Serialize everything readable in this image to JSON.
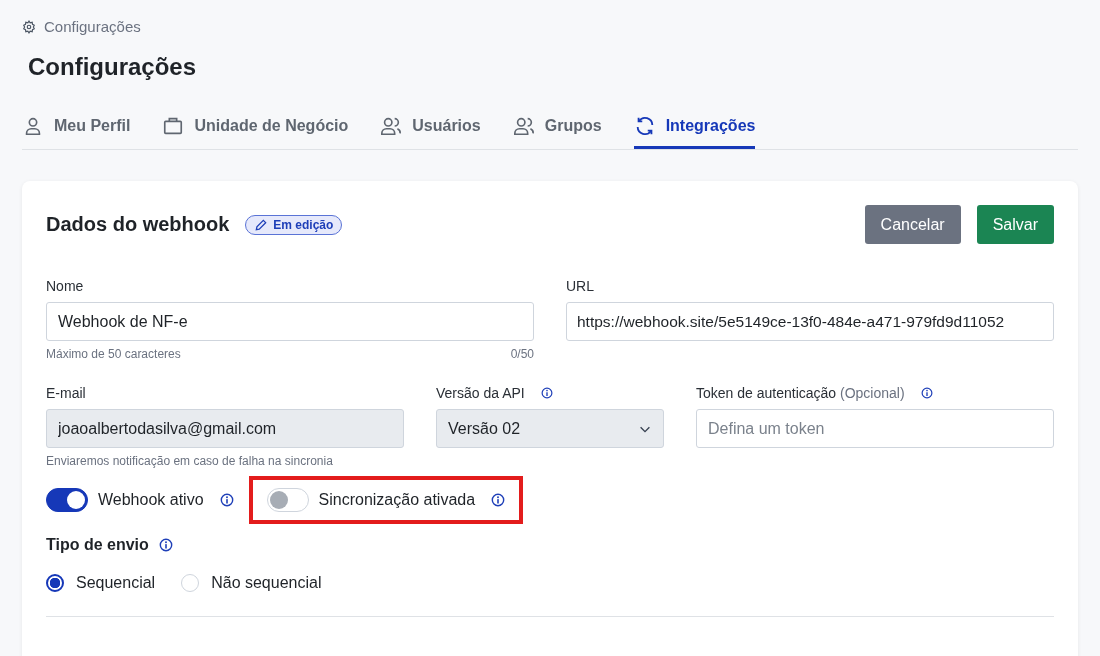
{
  "breadcrumb": {
    "label": "Configurações"
  },
  "title": "Configurações",
  "tabs": [
    {
      "label": "Meu Perfil",
      "kind": "profile",
      "selected": false
    },
    {
      "label": "Unidade de Negócio",
      "kind": "business",
      "selected": false
    },
    {
      "label": "Usuários",
      "kind": "users",
      "selected": false
    },
    {
      "label": "Grupos",
      "kind": "users",
      "selected": false
    },
    {
      "label": "Integrações",
      "kind": "sync",
      "selected": true
    }
  ],
  "card": {
    "title": "Dados do webhook",
    "status_badge": "Em edição",
    "buttons": [
      {
        "label": "Cancelar",
        "kind": "secondary"
      },
      {
        "label": "Salvar",
        "kind": "primary"
      }
    ],
    "name": {
      "label": "Nome",
      "value": "Webhook de NF-e",
      "hint": "Máximo de 50 caracteres",
      "counter": "0/50"
    },
    "url": {
      "label": "URL",
      "value": "https://webhook.site/5e5149ce-13f0-484e-a471-979fd9d11052"
    },
    "email": {
      "label": "E-mail",
      "value": "joaoalbertodasilva@gmail.com",
      "disabled": true,
      "hint": "Enviaremos notificação em caso de falha na sincronia"
    },
    "api_version": {
      "label": "Versão da API",
      "value": "Versão 02",
      "disabled": true
    },
    "token": {
      "label": "Token de autenticação",
      "optional": "(Opcional)",
      "placeholder": "Defina um token"
    },
    "toggles": [
      {
        "label": "Webhook ativo",
        "on": true,
        "highlighted": false
      },
      {
        "label": "Sincronização ativada",
        "on": false,
        "highlighted": true
      }
    ],
    "send_type": {
      "label": "Tipo de envio",
      "options": [
        {
          "label": "Sequencial",
          "selected": true
        },
        {
          "label": "Não sequencial",
          "selected": false
        }
      ]
    }
  }
}
